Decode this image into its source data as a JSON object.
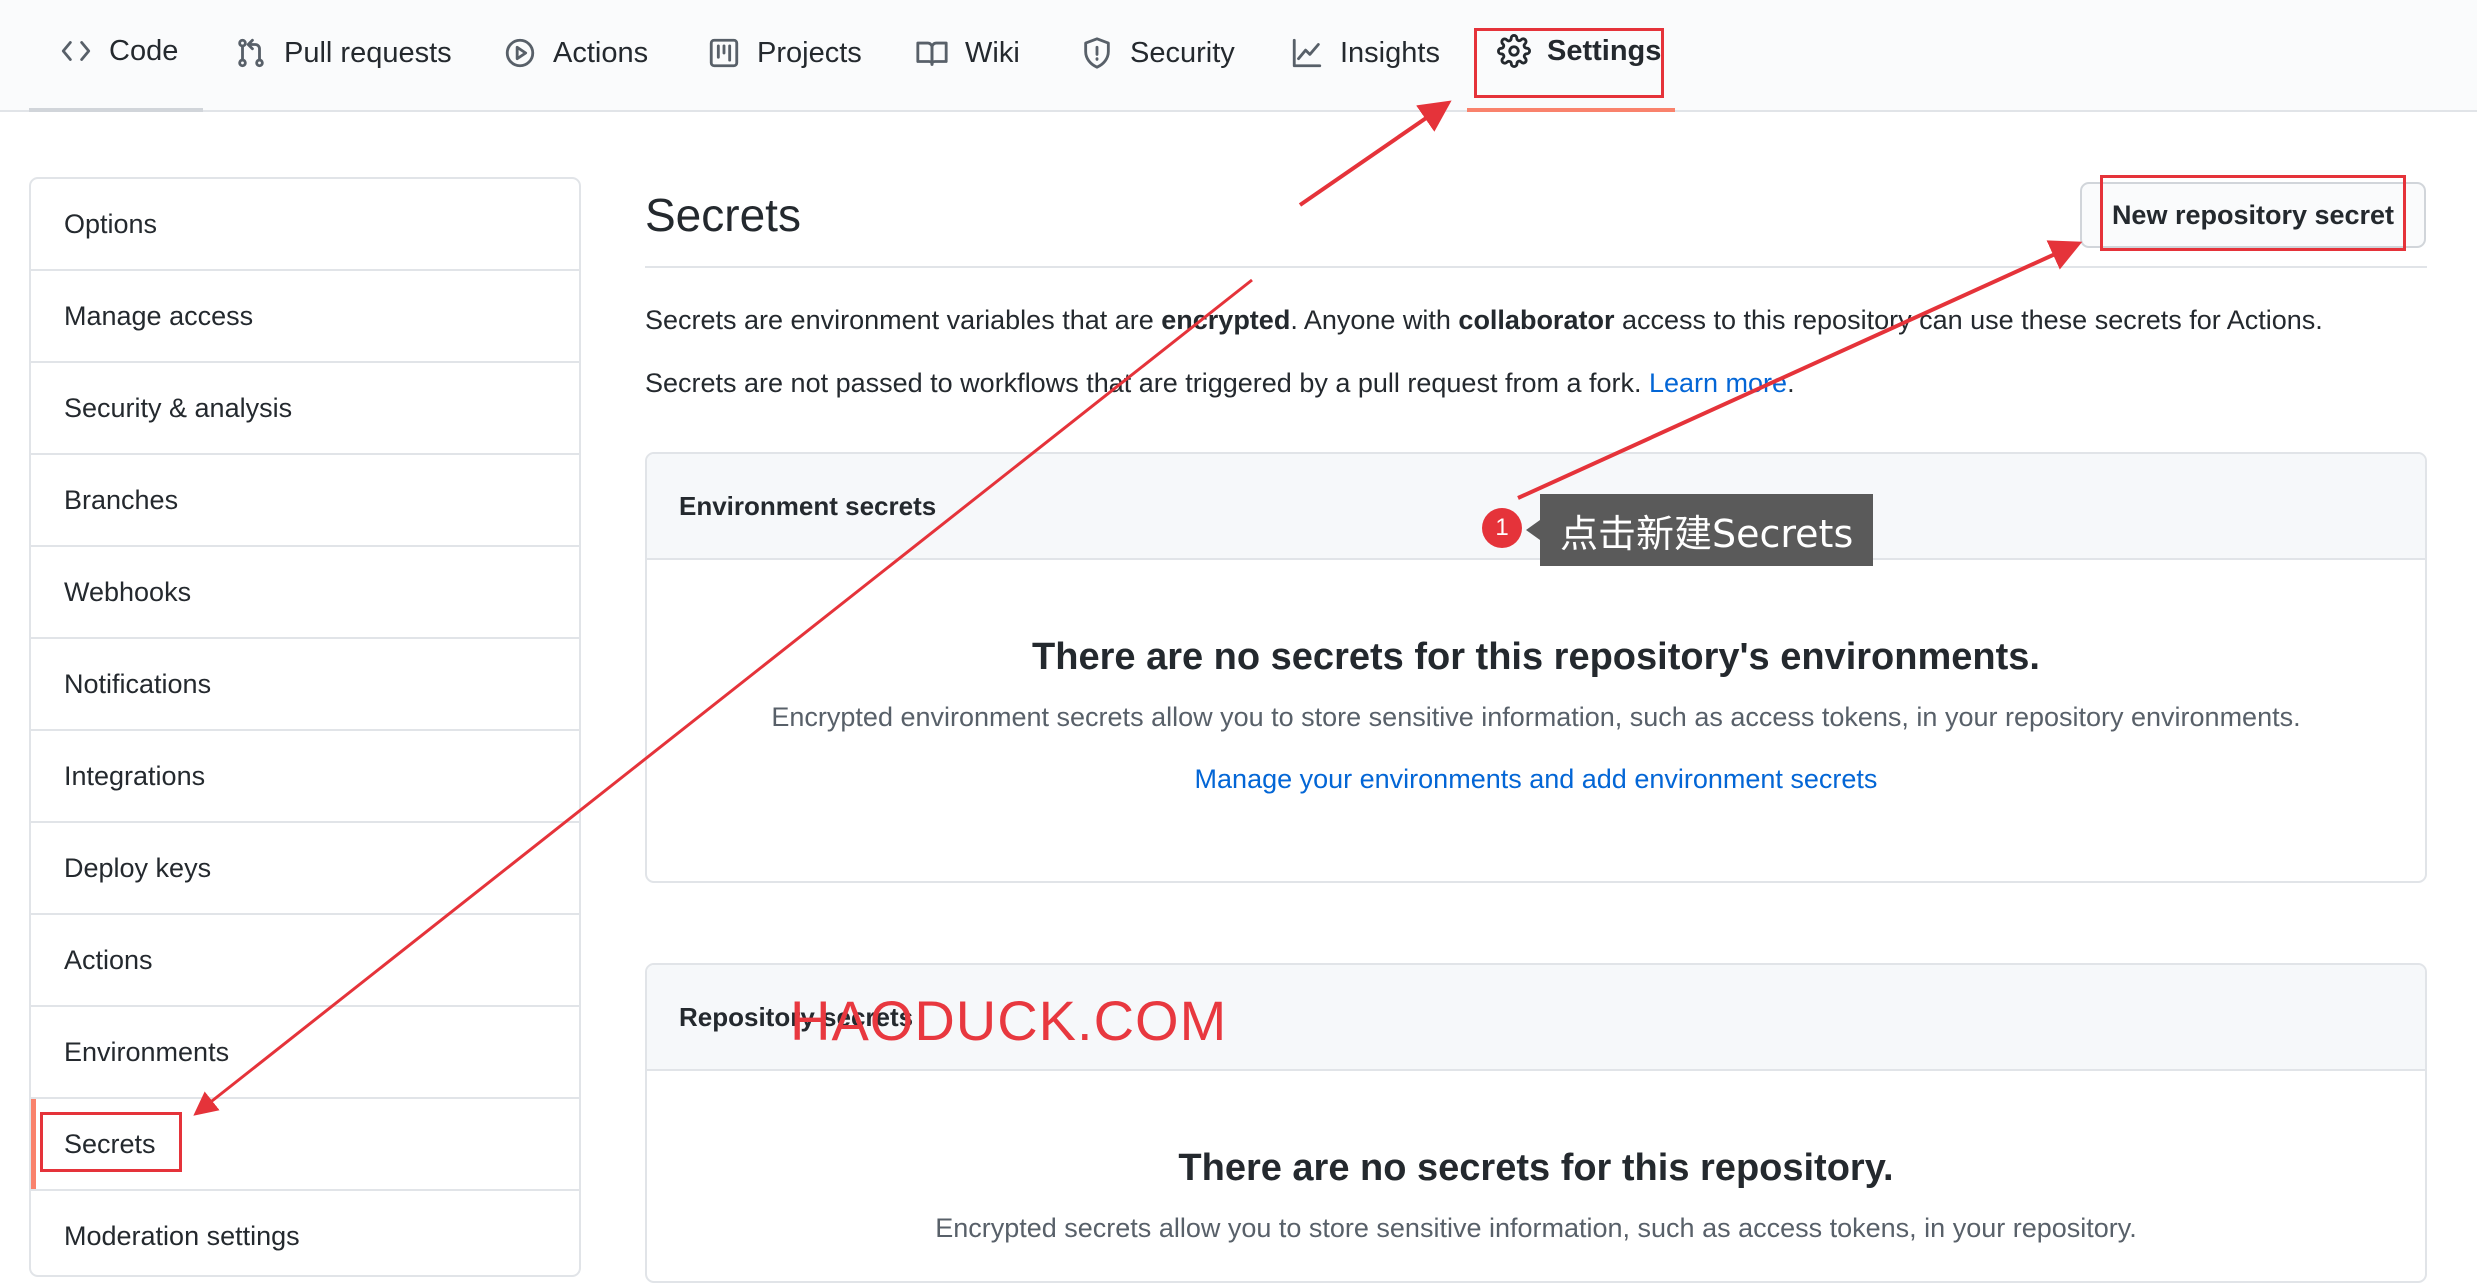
{
  "nav": {
    "tabs": [
      {
        "label": "Code",
        "icon": "code-icon"
      },
      {
        "label": "Pull requests",
        "icon": "pull-request-icon"
      },
      {
        "label": "Actions",
        "icon": "play-icon"
      },
      {
        "label": "Projects",
        "icon": "project-icon"
      },
      {
        "label": "Wiki",
        "icon": "book-icon"
      },
      {
        "label": "Security",
        "icon": "shield-icon"
      },
      {
        "label": "Insights",
        "icon": "graph-icon"
      },
      {
        "label": "Settings",
        "icon": "gear-icon",
        "selected": true
      }
    ]
  },
  "sidebar": {
    "items": [
      {
        "label": "Options"
      },
      {
        "label": "Manage access"
      },
      {
        "label": "Security & analysis"
      },
      {
        "label": "Branches"
      },
      {
        "label": "Webhooks"
      },
      {
        "label": "Notifications"
      },
      {
        "label": "Integrations"
      },
      {
        "label": "Deploy keys"
      },
      {
        "label": "Actions"
      },
      {
        "label": "Environments"
      },
      {
        "label": "Secrets",
        "active": true
      },
      {
        "label": "Moderation settings"
      }
    ]
  },
  "main": {
    "title": "Secrets",
    "new_secret_button": "New repository secret",
    "desc1": {
      "pre": "Secrets are environment variables that are ",
      "bold1": "encrypted",
      "mid": ". Anyone with ",
      "bold2": "collaborator",
      "post": " access to this repository can use these secrets for Actions."
    },
    "desc2": {
      "pre": "Secrets are not passed to workflows that are triggered by a pull request from a fork. ",
      "link": "Learn more",
      "post": "."
    },
    "env_box": {
      "header": "Environment secrets",
      "blank_title": "There are no secrets for this repository's environments.",
      "blank_desc": "Encrypted environment secrets allow you to store sensitive information, such as access tokens, in your repository environments.",
      "blank_link": "Manage your environments and add environment secrets"
    },
    "repo_box": {
      "header": "Repository secrets",
      "blank_title": "There are no secrets for this repository.",
      "blank_desc": "Encrypted secrets allow you to store sensitive information, such as access tokens, in your repository."
    }
  },
  "annotation": {
    "step_number": "1",
    "tooltip": "点击新建Secrets",
    "watermark": "HAODUCK.COM",
    "color": "#e5333a"
  },
  "colors": {
    "accent_underline": "#f9826c",
    "link": "#0366d6",
    "border": "#e1e4e8"
  }
}
